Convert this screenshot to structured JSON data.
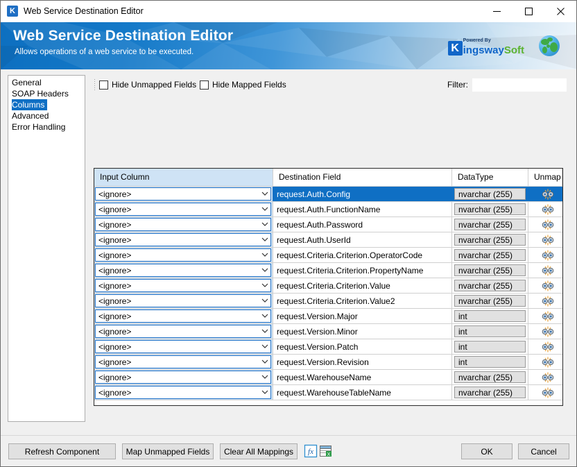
{
  "window": {
    "title": "Web Service Destination Editor",
    "icon": "kingswaysoft-k-icon",
    "minimize_label": "Minimize",
    "maximize_label": "Maximize",
    "close_label": "Close"
  },
  "banner": {
    "title": "Web Service Destination Editor",
    "subtitle": "Allows operations of a web service to be executed.",
    "brand_k": "K",
    "brand_powered": "Powered By",
    "brand_name_1": "ingsway",
    "brand_name_2": "Soft"
  },
  "sidebar": {
    "items": [
      {
        "label": "General",
        "selected": false
      },
      {
        "label": "SOAP Headers",
        "selected": false
      },
      {
        "label": "Columns",
        "selected": true
      },
      {
        "label": "Advanced",
        "selected": false
      },
      {
        "label": "Error Handling",
        "selected": false
      }
    ]
  },
  "toolbar": {
    "hide_unmapped_label": "Hide Unmapped Fields",
    "hide_unmapped_checked": false,
    "hide_mapped_label": "Hide Mapped Fields",
    "hide_mapped_checked": false,
    "filter_label": "Filter:",
    "filter_value": "",
    "filter_placeholder": ""
  },
  "grid": {
    "columns": [
      "Input Column",
      "Destination Field",
      "DataType",
      "Unmap"
    ],
    "rows": [
      {
        "input": "<ignore>",
        "destination": "request.Auth.Config",
        "datatype": "nvarchar (255)",
        "selected": true
      },
      {
        "input": "<ignore>",
        "destination": "request.Auth.FunctionName",
        "datatype": "nvarchar (255)",
        "selected": false
      },
      {
        "input": "<ignore>",
        "destination": "request.Auth.Password",
        "datatype": "nvarchar (255)",
        "selected": false
      },
      {
        "input": "<ignore>",
        "destination": "request.Auth.UserId",
        "datatype": "nvarchar (255)",
        "selected": false
      },
      {
        "input": "<ignore>",
        "destination": "request.Criteria.Criterion.OperatorCode",
        "datatype": "nvarchar (255)",
        "selected": false
      },
      {
        "input": "<ignore>",
        "destination": "request.Criteria.Criterion.PropertyName",
        "datatype": "nvarchar (255)",
        "selected": false
      },
      {
        "input": "<ignore>",
        "destination": "request.Criteria.Criterion.Value",
        "datatype": "nvarchar (255)",
        "selected": false
      },
      {
        "input": "<ignore>",
        "destination": "request.Criteria.Criterion.Value2",
        "datatype": "nvarchar (255)",
        "selected": false
      },
      {
        "input": "<ignore>",
        "destination": "request.Version.Major",
        "datatype": "int",
        "selected": false
      },
      {
        "input": "<ignore>",
        "destination": "request.Version.Minor",
        "datatype": "int",
        "selected": false
      },
      {
        "input": "<ignore>",
        "destination": "request.Version.Patch",
        "datatype": "int",
        "selected": false
      },
      {
        "input": "<ignore>",
        "destination": "request.Version.Revision",
        "datatype": "int",
        "selected": false
      },
      {
        "input": "<ignore>",
        "destination": "request.WarehouseName",
        "datatype": "nvarchar (255)",
        "selected": false
      },
      {
        "input": "<ignore>",
        "destination": "request.WarehouseTableName",
        "datatype": "nvarchar (255)",
        "selected": false
      }
    ]
  },
  "footer": {
    "refresh_component": "Refresh Component",
    "map_unmapped_fields": "Map Unmapped Fields",
    "clear_all_mappings": "Clear All Mappings",
    "fx_icon": "fx-expression-icon",
    "export_icon": "export-to-excel-icon",
    "ok": "OK",
    "cancel": "Cancel"
  },
  "colors": {
    "accent": "#0f6fc4",
    "header_cell": "#cfe3f5",
    "banner_start": "#0d6fc0",
    "banner_end": "#eef5fb",
    "brand_green": "#5bb431"
  }
}
